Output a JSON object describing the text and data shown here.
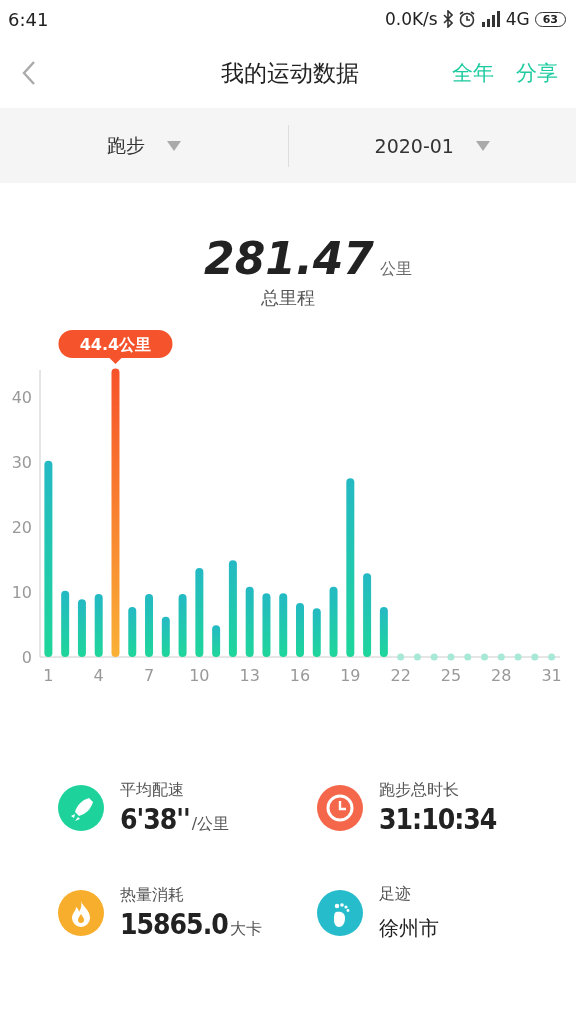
{
  "status_bar": {
    "time": "6:41",
    "speed": "0.0K/s",
    "network": "4G",
    "battery": "63"
  },
  "header": {
    "title": "我的运动数据",
    "actions": [
      "全年",
      "分享"
    ]
  },
  "filters": [
    {
      "label": "跑步"
    },
    {
      "label": "2020-01"
    }
  ],
  "total": {
    "value": "281.47",
    "unit": "公里",
    "label": "总里程"
  },
  "chart_data": {
    "type": "bar",
    "x": [
      1,
      2,
      3,
      4,
      5,
      6,
      7,
      8,
      9,
      10,
      11,
      12,
      13,
      14,
      15,
      16,
      17,
      18,
      19,
      20,
      21,
      22,
      23,
      24,
      25,
      26,
      27,
      28,
      29,
      30,
      31
    ],
    "values": [
      30.2,
      10.2,
      8.9,
      9.7,
      44.4,
      7.7,
      9.7,
      6.2,
      9.7,
      13.7,
      4.9,
      14.9,
      10.8,
      9.8,
      9.8,
      8.3,
      7.5,
      10.8,
      27.5,
      12.9,
      7.7,
      0,
      0,
      0,
      0,
      0,
      0,
      0,
      0,
      0,
      0
    ],
    "xlim": [
      0.5,
      31.5
    ],
    "ylim": [
      0,
      44.4
    ],
    "yticks": [
      0,
      10,
      20,
      30,
      40
    ],
    "xticks": [
      1,
      4,
      7,
      10,
      13,
      16,
      19,
      22,
      25,
      28,
      31
    ],
    "annotations": [
      "44.4公里"
    ]
  },
  "stats": [
    {
      "kind": "rocket",
      "color": "#1ed39b",
      "label": "平均配速",
      "value": "6'38''",
      "unit": "/公里"
    },
    {
      "kind": "clock",
      "color": "#f5674a",
      "label": "跑步总时长",
      "value": "31:10:34"
    },
    {
      "kind": "fire",
      "color": "#f7ae2d",
      "label": "热量消耗",
      "value": "15865.0",
      "unit": "大卡"
    },
    {
      "kind": "foot",
      "color": "#27bccb",
      "label": "足迹",
      "place": "徐州市"
    }
  ]
}
